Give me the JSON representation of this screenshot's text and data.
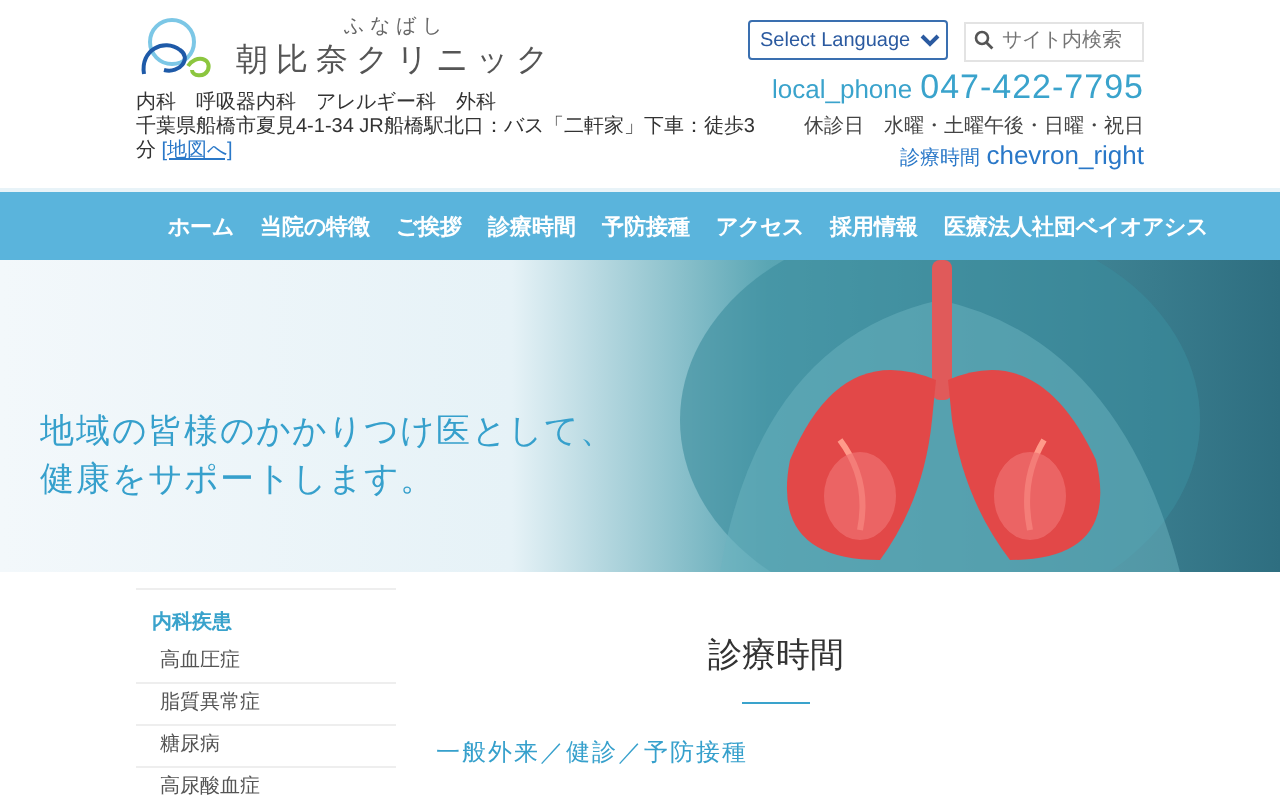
{
  "header": {
    "logo": {
      "kana": "ふなばし",
      "name": "朝比奈クリニック"
    },
    "departments": "内科　呼吸器内科　アレルギー科　外科",
    "address": "千葉県船橋市夏見4-1-34 JR船橋駅北口：バス「二軒家」下車：徒歩3分",
    "map_link": "[地図へ]",
    "language_select": {
      "value": "Select Language"
    },
    "search": {
      "placeholder": "サイト内検索"
    },
    "phone_icon_text": "local_phone",
    "phone": "047-422-7795",
    "closed_days": "休診日　水曜・土曜午後・日曜・祝日",
    "hours_link": "診療時間",
    "hours_icon_text": "chevron_right"
  },
  "nav": [
    {
      "label": "ホーム"
    },
    {
      "label": "当院の特徴"
    },
    {
      "label": "ご挨拶"
    },
    {
      "label": "診療時間"
    },
    {
      "label": "予防接種"
    },
    {
      "label": "アクセス"
    },
    {
      "label": "採用情報"
    },
    {
      "label": "医療法人社団ベイオアシス"
    }
  ],
  "hero": {
    "kind": "picture",
    "tagline_lines": [
      "地域の皆様のかかりつけ医として、",
      "健康をサポートします。"
    ]
  },
  "sidebar": {
    "heading": "内科疾患",
    "items": [
      {
        "label": "高血圧症"
      },
      {
        "label": "脂質異常症"
      },
      {
        "label": "糖尿病"
      },
      {
        "label": "高尿酸血症"
      }
    ]
  },
  "main": {
    "title": "診療時間",
    "subtitle": "一般外来／健診／予防接種"
  }
}
